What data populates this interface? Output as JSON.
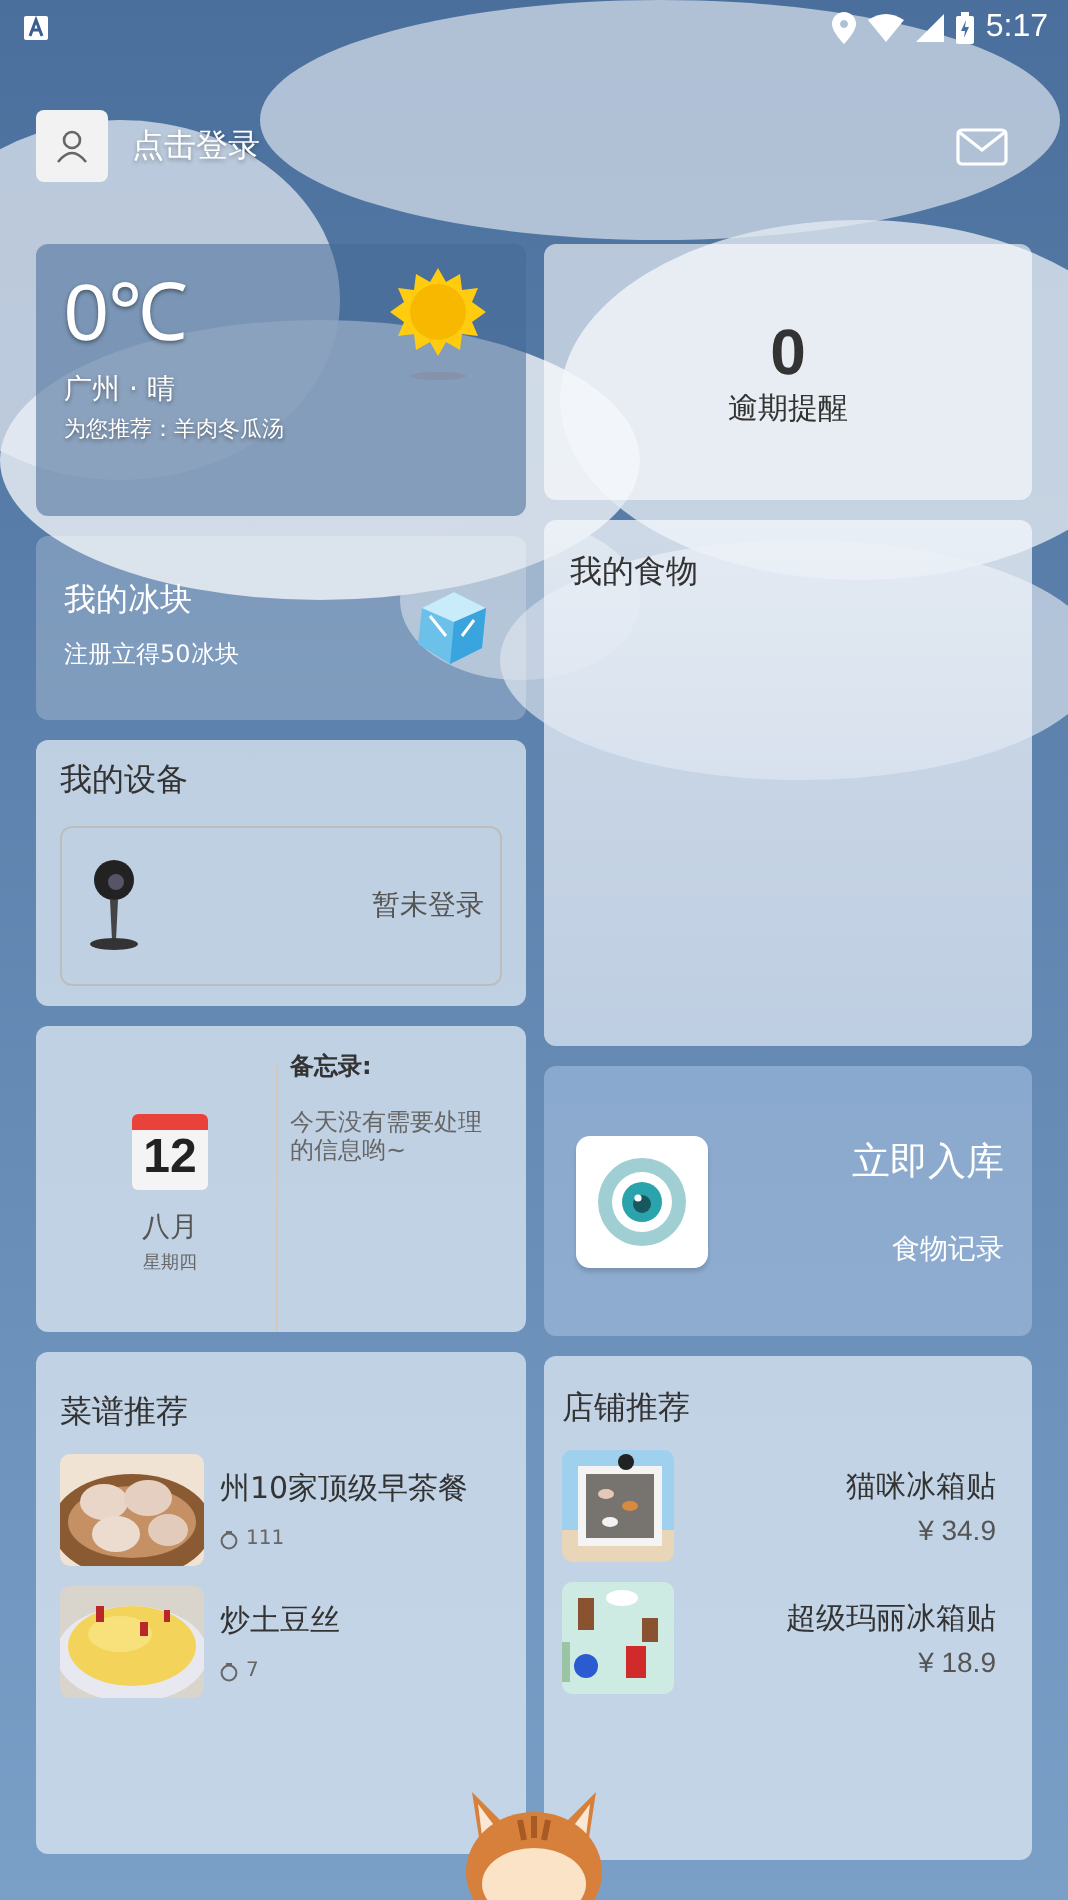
{
  "status_bar": {
    "time": "5:17"
  },
  "header": {
    "login": "点击登录"
  },
  "weather": {
    "temperature": "0℃",
    "location": "广州 · 晴",
    "recommendation": "为您推荐：羊肉冬瓜汤"
  },
  "overdue": {
    "count": "0",
    "label": "逾期提醒"
  },
  "ice": {
    "title": "我的冰块",
    "subtitle": "注册立得50冰块"
  },
  "food": {
    "title": "我的食物"
  },
  "devices": {
    "title": "我的设备",
    "status": "暂未登录"
  },
  "calendar": {
    "day": "12",
    "month": "八月",
    "weekday": "星期四",
    "memo_title": "备忘录:",
    "memo_text": "今天没有需要处理的信息哟~"
  },
  "stock_in": {
    "title": "立即入库",
    "subtitle": "食物记录"
  },
  "recipes": {
    "title": "菜谱推荐",
    "items": [
      {
        "name": "州10家顶级早茶餐",
        "likes": "111"
      },
      {
        "name": "炒土豆丝",
        "likes": "7"
      }
    ]
  },
  "shop": {
    "title": "店铺推荐",
    "items": [
      {
        "name": "猫咪冰箱贴",
        "price": "¥ 34.9"
      },
      {
        "name": "超级玛丽冰箱贴",
        "price": "¥ 18.9"
      }
    ]
  }
}
